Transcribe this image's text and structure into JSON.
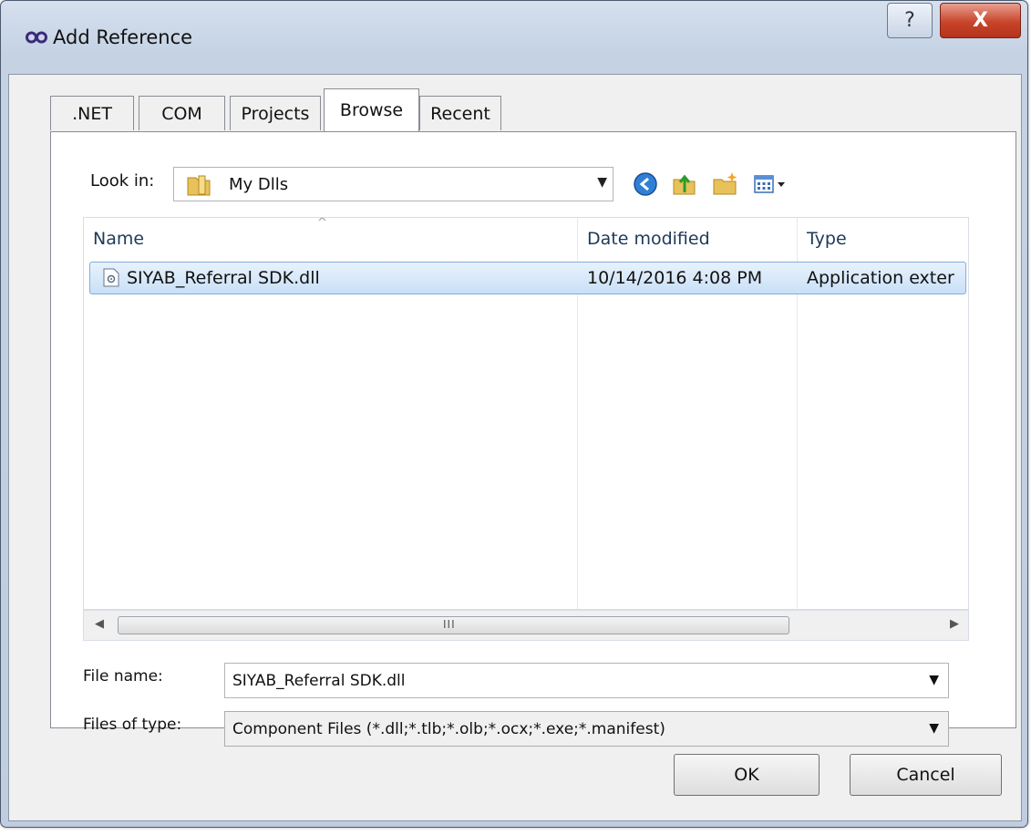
{
  "window": {
    "title": "Add Reference",
    "help_glyph": "?",
    "close_glyph": "X"
  },
  "tabs": [
    {
      "label": ".NET",
      "active": false
    },
    {
      "label": "COM",
      "active": false
    },
    {
      "label": "Projects",
      "active": false
    },
    {
      "label": "Browse",
      "active": true
    },
    {
      "label": "Recent",
      "active": false
    }
  ],
  "lookin": {
    "label": "Look in:",
    "value": "My Dlls",
    "arrow": "▼"
  },
  "toolbar_icons": [
    "back-icon",
    "up-folder-icon",
    "new-folder-icon",
    "view-menu-icon"
  ],
  "list": {
    "columns": [
      "Name",
      "Date modified",
      "Type"
    ],
    "sort_glyph": "^",
    "rows": [
      {
        "name": "SIYAB_Referral SDK.dll",
        "date": "10/14/2016 4:08 PM",
        "type": "Application exter",
        "selected": true
      }
    ]
  },
  "scrollbar": {
    "left_arrow": "◀",
    "right_arrow": "▶",
    "grip": "III"
  },
  "file_name": {
    "label": "File name:",
    "value": "SIYAB_Referral SDK.dll",
    "arrow": "▼"
  },
  "file_type": {
    "label": "Files of type:",
    "value": "Component Files (*.dll;*.tlb;*.olb;*.ocx;*.exe;*.manifest)",
    "arrow": "▼"
  },
  "buttons": {
    "ok": "OK",
    "cancel": "Cancel"
  },
  "colors": {
    "selection": "#c9e0f7",
    "titlebar": "#c4d2e4",
    "close": "#c8452b"
  }
}
